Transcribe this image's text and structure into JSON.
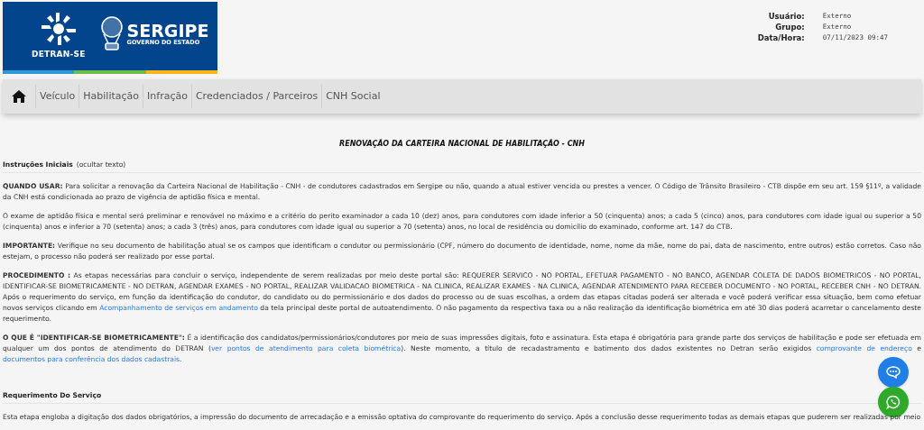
{
  "logo": {
    "agency": "DETRAN-SE",
    "state": "SERGIPE",
    "government": "GOVERNO DO ESTADO"
  },
  "user_info": [
    {
      "label": "Usuário:",
      "value": "Externo"
    },
    {
      "label": "Grupo:",
      "value": "Externo"
    },
    {
      "label": "Data/Hora:",
      "value": "07/11/2023 09:47"
    }
  ],
  "nav": [
    "Veículo",
    "Habilitação",
    "Infração",
    "Credenciados / Parceiros",
    "CNH Social"
  ],
  "page_title": "RENOVAÇÃO DA CARTEIRA NACIONAL DE HABILITAÇÃO - CNH",
  "sections": [
    {
      "title": "Instruções Iniciais",
      "toggle": "(ocultar texto)",
      "paragraphs": [
        [
          {
            "kind": "text",
            "text": "**QUANDO USAR:** Para solicitar a renovação da Carteira Nacional de Habilitação - CNH - de condutores cadastrados em Sergipe ou não, quando a atual estiver vencida ou prestes a vencer. O Código de Trânsito Brasileiro - CTB dispõe em seu art. 159 §11º, a validade da CNH está condicionada ao prazo de vigência de aptidão física e mental."
          }
        ],
        [
          {
            "kind": "text",
            "text": "O exame de aptidão física e mental será preliminar e renovável no máximo e a critério do perito examinador a cada 10 (dez) anos, para condutores com idade inferior a 50 (cinquenta) anos; a cada 5 (cinco) anos, para condutores com idade igual ou superior a 50 (cinquenta) anos e inferior a 70 (setenta) anos; a cada 3 (três) anos, para condutores com idade igual ou superior a 70 (setenta) anos, no local de residência ou domicílio do examinado, conforme art. 147 do CTB."
          }
        ],
        [
          {
            "kind": "text",
            "text": "**IMPORTANTE:** Verifique no seu documento de habilitação atual se os campos que identificam o condutor ou permissionário (CPF, número do documento de identidade, nome, nome da mãe, nome do pai, data de nascimento, entre outros) estão corretos. Caso não estejam, o processo não poderá ser realizado por esse portal."
          }
        ],
        [
          {
            "kind": "text",
            "text": "**PROCEDIMENTO :** As etapas necessárias para concluir o serviço, independente de serem realizadas por meio deste portal são: REQUERER SERVICO - NO PORTAL, EFETUAR PAGAMENTO - NO BANCO, AGENDAR COLETA DE DADOS BIOMETRICOS - NO PORTAL, IDENTIFICAR-SE BIOMETRICAMENTE - NO DETRAN, AGENDAR EXAMES - NO PORTAL, REALIZAR VALIDACAO BIOMETRICA - NA CLINICA, REALIZAR EXAMES - NA CLINICA, AGENDAR ATENDIMENTO PARA RECEBER DOCUMENTO - NO PORTAL, RECEBER CNH - NO DETRAN. Após o requerimento do serviço, em função da identificação do condutor, do candidato ou do permissionário e dos dados do processo ou de suas escolhas, a ordem das etapas citadas poderá ser alterada e você poderá verificar essa situação, bem como efetuar novos serviços clicando em "
          },
          {
            "kind": "link",
            "text": "Acompanhamento de serviços em andamento"
          },
          {
            "kind": "text",
            "text": " da tela principal deste portal de autoatendimento. O não pagamento da respectiva taxa ou a não realização da identificação biométrica em até 30 dias poderá acarretar o cancelamento deste requerimento."
          }
        ],
        [
          {
            "kind": "text",
            "text": "**O QUE É \"IDENTIFICAR-SE BIOMETRICAMENTE\":** É a identificação dos candidatos/permissionários/condutores por meio de suas impressões digitais, foto e assinatura. Esta etapa é obrigatória para grande parte dos serviços de habilitação e pode ser efetuada em qualquer um dos pontos de atendimento do DETRAN ("
          },
          {
            "kind": "link",
            "text": "ver pontos de atendimento para coleta biométrica"
          },
          {
            "kind": "text",
            "text": "). Neste momento, a título de recadastramento e batimento dos dados existentes no Detran serão exigidos "
          },
          {
            "kind": "link",
            "text": "comprovante de endereço"
          },
          {
            "kind": "text",
            "text": " e "
          },
          {
            "kind": "link",
            "text": "documentos para conferência dos dados cadastrais"
          },
          {
            "kind": "text",
            "text": "."
          }
        ]
      ]
    },
    {
      "title": "Requerimento Do Serviço",
      "paragraphs": [
        [
          {
            "kind": "text",
            "text": "Esta etapa engloba a digitação dos dados obrigatórios, a impressão do documento de arrecadação e a emissão optativa do comprovante do requerimento do serviço. Após a conclusão desse requerimento todas as demais etapas que puderem ser realizadas por meio"
          }
        ]
      ]
    }
  ]
}
